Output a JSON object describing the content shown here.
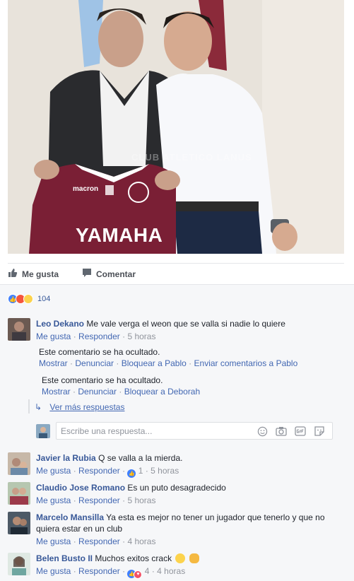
{
  "photo": {
    "watermark": "CLUB ATLETICO LANUS",
    "shirt_brand": "macron",
    "shirt_sponsor": "YAMAHA"
  },
  "actions": {
    "like_label": "Me gusta",
    "comment_label": "Comentar"
  },
  "reactions": {
    "count": "104",
    "types": [
      "like",
      "angry",
      "haha"
    ]
  },
  "comments": [
    {
      "author": "Leo Dekano",
      "text": "Me vale verga el weon que se valla si nadie lo quiere",
      "like_label": "Me gusta",
      "reply_label": "Responder",
      "time": "5 horas"
    },
    {
      "author": "Javier la Rubia",
      "text": "Q se valla a la mierda.",
      "like_label": "Me gusta",
      "reply_label": "Responder",
      "reaction_count": "1",
      "time": "5 horas"
    },
    {
      "author": "Claudio Jose Romano",
      "text": "Es un puto desagradecido",
      "like_label": "Me gusta",
      "reply_label": "Responder",
      "time": "5 horas"
    },
    {
      "author": "Marcelo Mansilla",
      "text_line1": "Ya esta es mejor no tener un jugador que tenerlo y que no",
      "text_line2": "quiera estar en un club",
      "like_label": "Me gusta",
      "reply_label": "Responder",
      "time": "4 horas"
    },
    {
      "author": "Belen Busto II",
      "text": "Muchos exitos crack",
      "like_label": "Me gusta",
      "reply_label": "Responder",
      "reaction_count": "4",
      "time": "4 horas"
    }
  ],
  "hidden_replies": [
    {
      "message": "Este comentario se ha ocultado.",
      "show_label": "Mostrar",
      "report_label": "Denunciar",
      "block_label": "Bloquear a Pablo",
      "feedback_label": "Enviar comentarios a Pablo"
    },
    {
      "message": "Este comentario se ha ocultado.",
      "show_label": "Mostrar",
      "report_label": "Denunciar",
      "block_label": "Bloquear a Deborah"
    }
  ],
  "more_replies_label": "Ver más respuestas",
  "reply_box": {
    "placeholder": "Escribe una respuesta..."
  },
  "colors": {
    "link": "#385898",
    "background": "#f6f7f9",
    "shirt": "#7a1f35"
  }
}
